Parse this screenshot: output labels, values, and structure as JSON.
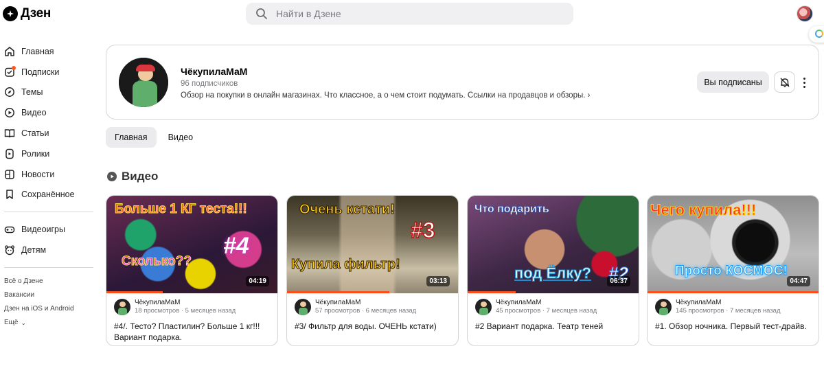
{
  "header": {
    "logo_text": "Дзен",
    "search_placeholder": "Найти в Дзене"
  },
  "sidebar": {
    "items": [
      {
        "label": "Главная",
        "icon": "home-icon"
      },
      {
        "label": "Подписки",
        "icon": "subscriptions-icon",
        "badge": true
      },
      {
        "label": "Темы",
        "icon": "compass-icon"
      },
      {
        "label": "Видео",
        "icon": "video-icon"
      },
      {
        "label": "Статьи",
        "icon": "book-icon"
      },
      {
        "label": "Ролики",
        "icon": "shorts-icon"
      },
      {
        "label": "Новости",
        "icon": "news-icon"
      },
      {
        "label": "Сохранённое",
        "icon": "bookmark-icon"
      }
    ],
    "secondary": [
      {
        "label": "Видеоигры",
        "icon": "gamepad-icon"
      },
      {
        "label": "Детям",
        "icon": "kids-icon"
      }
    ],
    "footer": [
      "Всё о Дзене",
      "Вакансии",
      "Дзен на iOS и Android",
      "Ещё"
    ]
  },
  "channel": {
    "name": "ЧёкупилаМаМ",
    "subscribers": "96 подписчиков",
    "description": "Обзор на покупки в онлайн магазинах. Что классное, а о чем стоит подумать. Ссылки на продавцов и обзоры.",
    "subscribed_label": "Вы подписаны"
  },
  "tabs": [
    "Главная",
    "Видео"
  ],
  "active_tab": 0,
  "section": {
    "title": "Видео"
  },
  "accent_color": "#ff4d1a",
  "videos": [
    {
      "author": "ЧёкупилаМаМ",
      "stats": "18 просмотров · 5 месяцев назад",
      "title": "#4/. Тесто? Пластилин? Больше 1 кг!!! Вариант подарка.",
      "duration": "04:19",
      "progress": 0.33,
      "overlay": [
        "Больше 1 КГ теста!!!",
        "#4",
        "Сколько??"
      ]
    },
    {
      "author": "ЧёкупилаМаМ",
      "stats": "57 просмотров · 6 месяцев назад",
      "title": "#3/ Фильтр для воды. ОЧЕНЬ кстати)",
      "duration": "03:13",
      "progress": 0.6,
      "overlay": [
        "Очень кстати!",
        "#3",
        "Купила фильтр!"
      ]
    },
    {
      "author": "ЧёкупилаМаМ",
      "stats": "45 просмотров · 7 месяцев назад",
      "title": "#2 Вариант подарка. Театр теней",
      "duration": "06:37",
      "progress": 0.28,
      "overlay": [
        "Что подарить",
        "#2",
        "под Ёлку?"
      ]
    },
    {
      "author": "ЧёкупилаМаМ",
      "stats": "145 просмотров · 7 месяцев назад",
      "title": "#1. Обзор ночника. Первый тест-драйв.",
      "duration": "04:47",
      "progress": 1.0,
      "overlay": [
        "Чего купила!!!",
        "",
        "Просто КОСМОС!"
      ]
    }
  ]
}
